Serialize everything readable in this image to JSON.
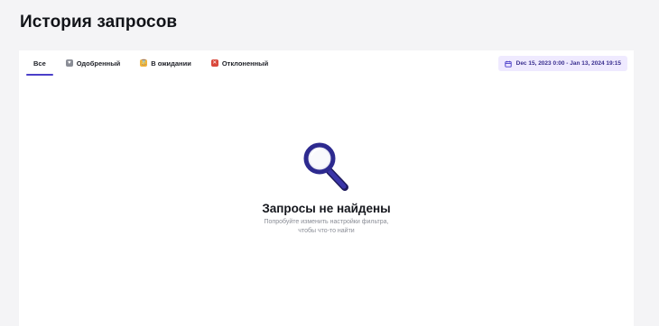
{
  "page": {
    "title": "История запросов"
  },
  "tabs": [
    {
      "label": "Все",
      "icon": "none",
      "active": true
    },
    {
      "label": "Одобренный",
      "icon": "approved-icon",
      "color": "#8a8d96"
    },
    {
      "label": "В ожидании",
      "icon": "pending-icon",
      "color": "#f0b43c"
    },
    {
      "label": "Отклоненный",
      "icon": "rejected-icon",
      "color": "#d9483b"
    }
  ],
  "date_filter": {
    "label": "Dec 15, 2023 0:00 - Jan 13, 2024 19:15",
    "icon": "calendar-icon"
  },
  "empty_state": {
    "icon": "magnifier-icon",
    "title": "Запросы не найдены",
    "hint_line1": "Попробуйте изменить настройки фильтра,",
    "hint_line2": "чтобы что-то найти"
  },
  "colors": {
    "accent": "#4b3fc9",
    "date_bg": "#efeaff"
  }
}
